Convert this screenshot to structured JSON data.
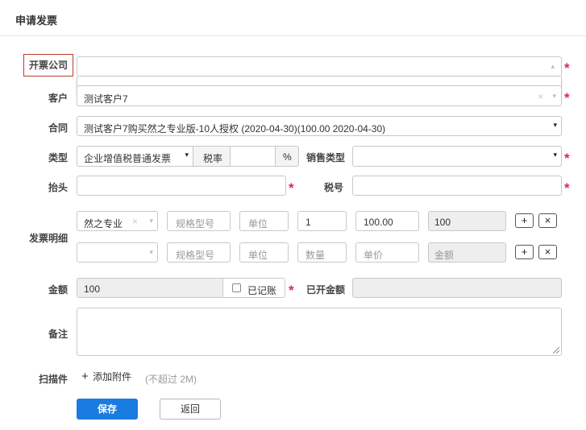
{
  "page": {
    "title": "申请发票"
  },
  "form": {
    "company": {
      "label": "开票公司",
      "value": ""
    },
    "customer": {
      "label": "客户",
      "value": "测试客户7"
    },
    "contract": {
      "label": "合同",
      "value": "测试客户7购买然之专业版-10人授权 (2020-04-30)(100.00 2020-04-30)"
    },
    "type": {
      "label": "类型",
      "value": "企业增值税普通发票",
      "tax_rate_label": "税率",
      "tax_rate_value": "",
      "percent": "%",
      "sales_type_label": "销售类型",
      "sales_type_value": ""
    },
    "header": {
      "label": "抬头",
      "value": ""
    },
    "tax_no": {
      "label": "税号",
      "value": ""
    },
    "details": {
      "label": "发票明细",
      "rows": [
        {
          "product": "然之专业",
          "spec": "",
          "spec_placeholder": "规格型号",
          "unit": "",
          "unit_placeholder": "单位",
          "qty": "1",
          "qty_placeholder": "数量",
          "price": "100.00",
          "price_placeholder": "单价",
          "amount": "100",
          "amount_placeholder": "金额"
        },
        {
          "product": "",
          "spec": "",
          "spec_placeholder": "规格型号",
          "unit": "",
          "unit_placeholder": "单位",
          "qty": "",
          "qty_placeholder": "数量",
          "price": "",
          "price_placeholder": "单价",
          "amount": "",
          "amount_placeholder": "金额"
        }
      ],
      "add_symbol": "+",
      "remove_symbol": "×"
    },
    "amount": {
      "label": "金额",
      "value": "100",
      "recorded_label": "已记账",
      "recorded_checked": false,
      "invoiced_label": "已开金额",
      "invoiced_value": ""
    },
    "remark": {
      "label": "备注",
      "value": ""
    },
    "attachment": {
      "label": "扫描件",
      "add_label": "添加附件",
      "hint": "(不超过 2M)"
    }
  },
  "actions": {
    "save": "保存",
    "back": "返回"
  },
  "symbols": {
    "caret_down": "▾",
    "caret_up": "▴",
    "star": "*",
    "clear": "×",
    "plus": "+"
  },
  "colors": {
    "primary": "#1a7be0",
    "required": "#e0245e",
    "focus_border": "#c0392b"
  }
}
